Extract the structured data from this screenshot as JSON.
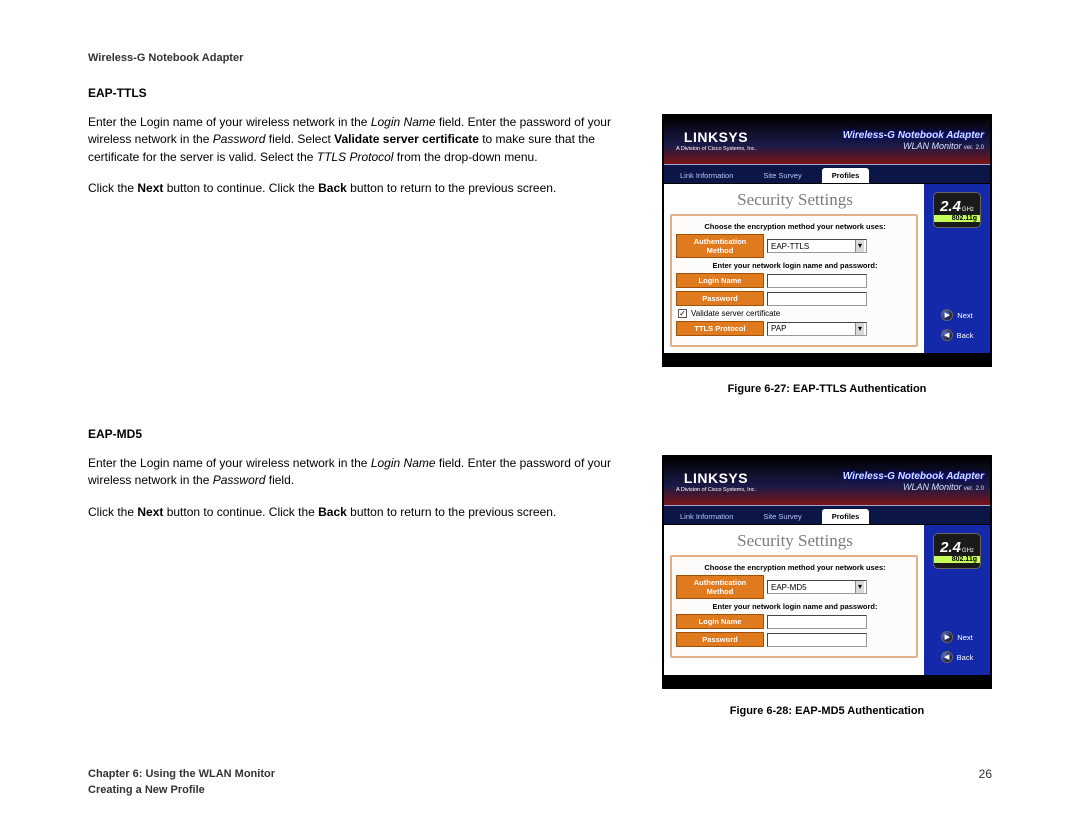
{
  "doc": {
    "header": "Wireless-G Notebook Adapter",
    "footer_chapter": "Chapter 6: Using the WLAN Monitor",
    "footer_section": "Creating a New Profile",
    "page_num": "26"
  },
  "sec1": {
    "title": "EAP-TTLS",
    "p1_a": "Enter the Login name of your wireless network in the ",
    "p1_b": "Login Name",
    "p1_c": " field. Enter the password of your wireless network in the ",
    "p1_d": "Password",
    "p1_e": " field. Select ",
    "p1_f": "Validate server certificate",
    "p1_g": " to make sure that the certificate for the server is valid. Select the ",
    "p1_h": "TTLS Protocol",
    "p1_i": " from the drop-down menu.",
    "p2_a": "Click the ",
    "p2_b": "Next",
    "p2_c": " button to continue. Click the ",
    "p2_d": "Back",
    "p2_e": " button to return to the previous screen.",
    "fig_caption": "Figure 6-27: EAP-TTLS Authentication"
  },
  "sec2": {
    "title": "EAP-MD5",
    "p1_a": "Enter the Login name of your wireless network in the ",
    "p1_b": "Login Name",
    "p1_c": " field. Enter the password of your wireless network in the ",
    "p1_d": "Password",
    "p1_e": " field.",
    "p2_a": "Click the ",
    "p2_b": "Next",
    "p2_c": " button to continue. Click the ",
    "p2_d": "Back",
    "p2_e": " button to return to the previous screen.",
    "fig_caption": "Figure 6-28: EAP-MD5 Authentication"
  },
  "shot": {
    "brand": "LINKSYS",
    "brand_sub": "A Division of Cisco Systems, Inc.",
    "prod_line": "Wireless-G Notebook Adapter",
    "wlan": "WLAN Monitor",
    "ver_prefix": "ver.",
    "ver": "2.0",
    "tabs": {
      "t1": "Link Information",
      "t2": "Site Survey",
      "t3": "Profiles"
    },
    "title": "Security Settings",
    "lbl_method": "Choose the encryption method your network uses:",
    "fl_method": "Authentication Method",
    "lbl_login": "Enter your network login name and password:",
    "fl_login": "Login Name",
    "fl_pass": "Password",
    "cb_validate": "Validate server certificate",
    "fl_ttls": "TTLS Protocol",
    "val_tls": "EAP-TTLS",
    "val_md5": "EAP-MD5",
    "val_pap": "PAP",
    "badge_n": "2.4",
    "badge_ghz": "GHz",
    "badge_std": "802.11g",
    "btn_next": "Next",
    "btn_back": "Back"
  }
}
